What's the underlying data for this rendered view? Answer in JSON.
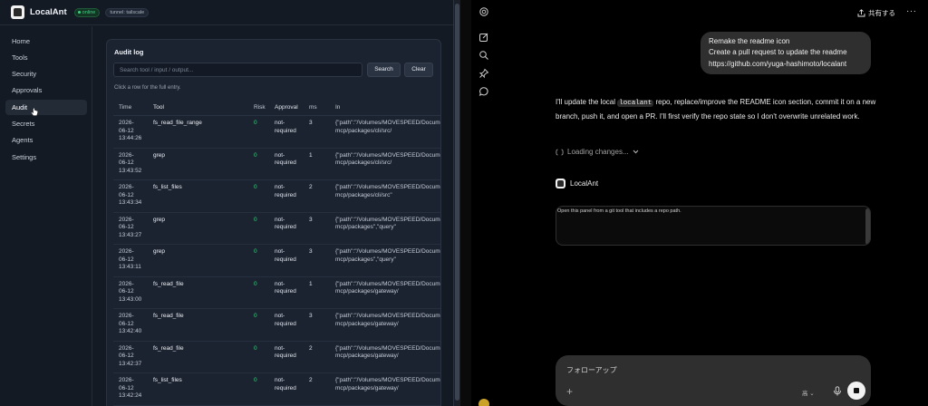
{
  "app": {
    "brand": "LocalAnt",
    "status": "online",
    "tunnel": "tunnel: tailscale"
  },
  "sidebar": {
    "items": [
      {
        "label": "Home"
      },
      {
        "label": "Tools"
      },
      {
        "label": "Security"
      },
      {
        "label": "Approvals"
      },
      {
        "label": "Audit",
        "active": true
      },
      {
        "label": "Secrets"
      },
      {
        "label": "Agents"
      },
      {
        "label": "Settings"
      }
    ]
  },
  "audit": {
    "title": "Audit log",
    "search_placeholder": "Search tool / input / output...",
    "search_label": "Search",
    "clear_label": "Clear",
    "hint": "Click a row for the full entry.",
    "columns": {
      "time": "Time",
      "tool": "Tool",
      "risk": "Risk",
      "approval": "Approval",
      "ms": "ms",
      "in": "In"
    },
    "rows": [
      {
        "time": "2026-\n06-12\n13:44:26",
        "tool": "fs_read_file_range",
        "risk": "0",
        "approval": "not-\nrequired",
        "ms": "3",
        "in": "{\"path\":\"/Volumes/MOVESPEED/Docume\nmcp/packages/cli/src/"
      },
      {
        "time": "2026-\n06-12\n13:43:52",
        "tool": "grep",
        "risk": "0",
        "approval": "not-\nrequired",
        "ms": "1",
        "in": "{\"path\":\"/Volumes/MOVESPEED/Docume\nmcp/packages/cli/src/"
      },
      {
        "time": "2026-\n06-12\n13:43:34",
        "tool": "fs_list_files",
        "risk": "0",
        "approval": "not-\nrequired",
        "ms": "2",
        "in": "{\"path\":\"/Volumes/MOVESPEED/Docume\nmcp/packages/cli/src\""
      },
      {
        "time": "2026-\n06-12\n13:43:27",
        "tool": "grep",
        "risk": "0",
        "approval": "not-\nrequired",
        "ms": "3",
        "in": "{\"path\":\"/Volumes/MOVESPEED/Docume\nmcp/packages\",\"query\""
      },
      {
        "time": "2026-\n06-12\n13:43:11",
        "tool": "grep",
        "risk": "0",
        "approval": "not-\nrequired",
        "ms": "3",
        "in": "{\"path\":\"/Volumes/MOVESPEED/Docume\nmcp/packages\",\"query\""
      },
      {
        "time": "2026-\n06-12\n13:43:00",
        "tool": "fs_read_file",
        "risk": "0",
        "approval": "not-\nrequired",
        "ms": "1",
        "in": "{\"path\":\"/Volumes/MOVESPEED/Docume\nmcp/packages/gateway/"
      },
      {
        "time": "2026-\n06-12\n13:42:40",
        "tool": "fs_read_file",
        "risk": "0",
        "approval": "not-\nrequired",
        "ms": "3",
        "in": "{\"path\":\"/Volumes/MOVESPEED/Docume\nmcp/packages/gateway/"
      },
      {
        "time": "2026-\n06-12\n13:42:37",
        "tool": "fs_read_file",
        "risk": "0",
        "approval": "not-\nrequired",
        "ms": "2",
        "in": "{\"path\":\"/Volumes/MOVESPEED/Docume\nmcp/packages/gateway/"
      },
      {
        "time": "2026-\n06-12\n13:42:24",
        "tool": "fs_list_files",
        "risk": "0",
        "approval": "not-\nrequired",
        "ms": "2",
        "in": "{\"path\":\"/Volumes/MOVESPEED/Docume\nmcp/packages/gateway/"
      }
    ]
  },
  "chat": {
    "share_label": "共有する",
    "more_label": "···",
    "user_message": [
      "Remake the readme icon",
      "Create a pull request to update the readme",
      "https://github.com/yuga-hashimoto/localant"
    ],
    "assistant": {
      "before_code": "I'll update the local ",
      "code": "localant",
      "after_code": " repo, replace/improve the README icon section, commit it on a new branch, push it, and open a PR. I'll first verify the repo state so I don't overwrite unrelated work."
    },
    "loading": "Loading changes...",
    "tool_name": "LocalAnt",
    "tool_message": "Open this panel from a git tool that includes a repo path.",
    "composer_placeholder": "フォローアップ",
    "model_label": "高 ⌄"
  },
  "colors": {
    "accent_green": "#3fd083",
    "left_bg": "#141a24",
    "chat_bg": "#000000"
  }
}
